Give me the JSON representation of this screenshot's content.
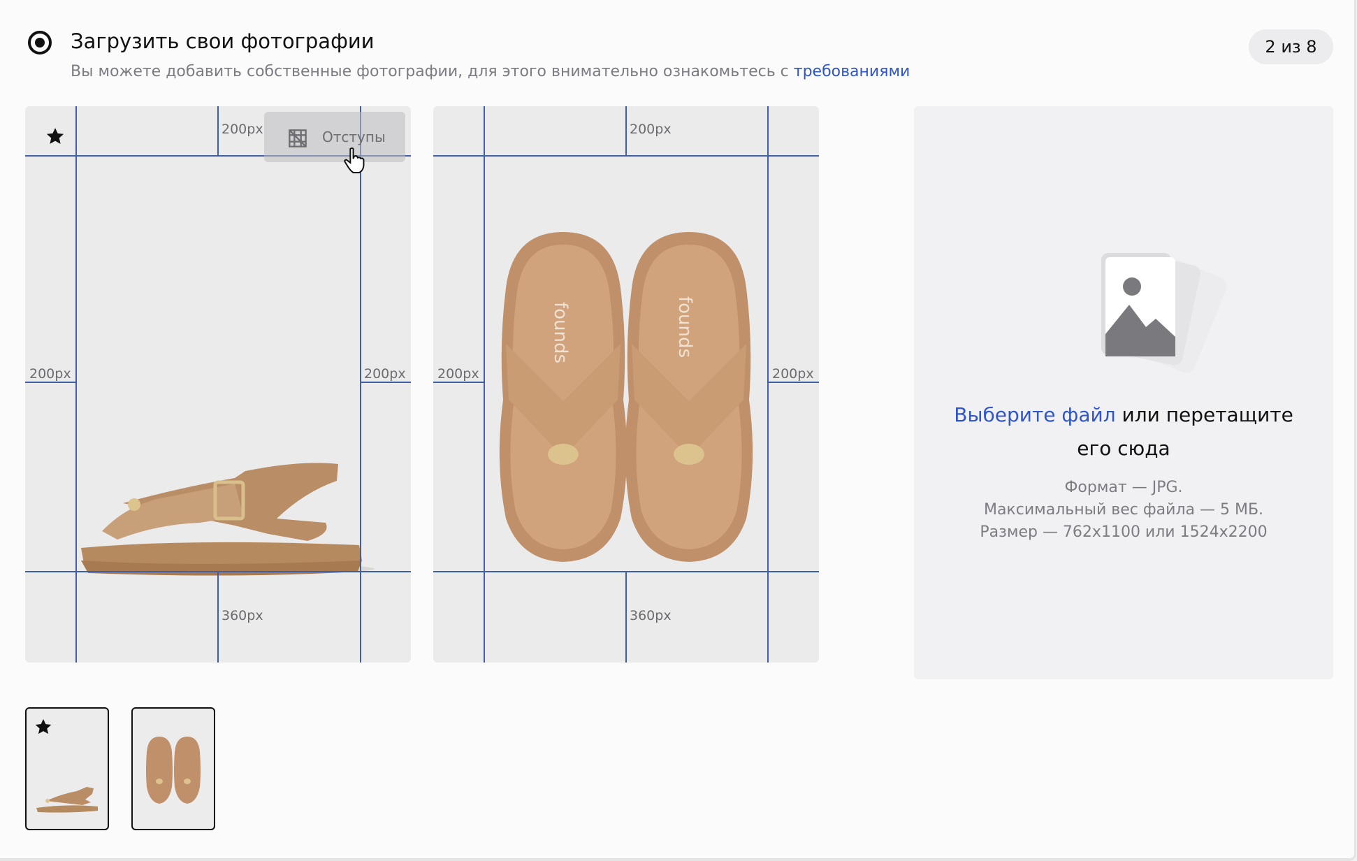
{
  "section": {
    "title": "Загрузить свои фотографии",
    "subtitle_text": "Вы можете добавить собственные фотографии, для этого внимательно ознакомьтесь с ",
    "subtitle_link": "требованиями",
    "counter": "2 из 8",
    "radio_selected": true
  },
  "photos": [
    {
      "label_top": "200px",
      "label_left": "200px",
      "label_right": "200px",
      "label_bottom": "360px",
      "is_main": true,
      "main_icon": "star-icon",
      "margins_button": "Отступы",
      "margins_icon": "grid-icon"
    },
    {
      "label_top": "200px",
      "label_left": "200px",
      "label_right": "200px",
      "label_bottom": "360px",
      "is_main": false,
      "brand_print": "founds"
    }
  ],
  "dropzone": {
    "link": "Выберите файл",
    "text": " или перетащите его сюда",
    "format": "Формат — JPG.",
    "max_size": "Максимальный вес файла — 5 МБ.",
    "dimensions": "Размер — 762х1100 или 1524х2200",
    "icon": "image-stack-icon"
  },
  "thumbnails": [
    {
      "is_main": true,
      "icon": "star-icon"
    },
    {
      "is_main": false
    }
  ],
  "colors": {
    "accent": "#2f56c7",
    "guide": "#3e5fa3",
    "sandal": "#c39a72"
  }
}
